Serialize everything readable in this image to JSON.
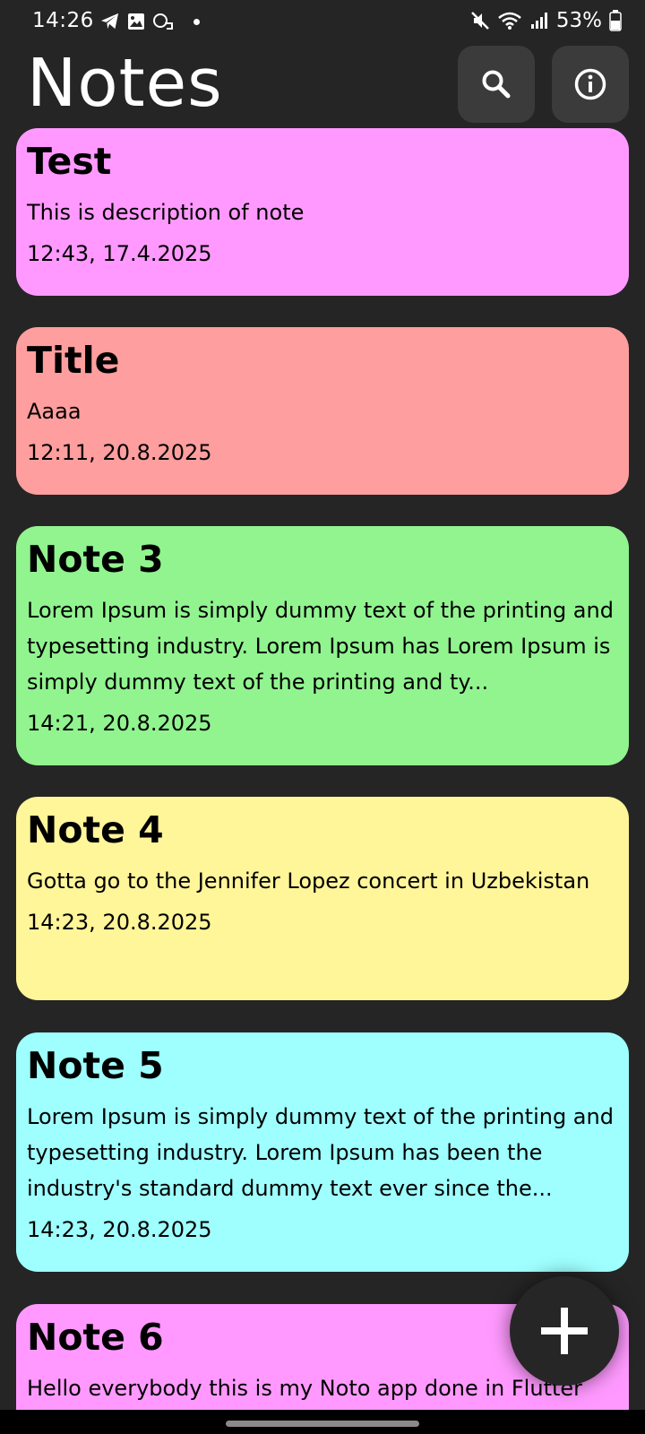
{
  "status_bar": {
    "time": "14:26",
    "battery_percent": "53%",
    "icons_left": [
      "telegram-icon",
      "gallery-icon",
      "link-icon",
      "notification-dot"
    ],
    "icons_right": [
      "mute-icon",
      "wifi-icon",
      "signal-icon",
      "battery-icon"
    ]
  },
  "header": {
    "title": "Notes",
    "search_icon": "search-icon",
    "info_icon": "info-icon"
  },
  "colors": {
    "background": "#252525",
    "header_button": "#3b3b3b",
    "pink": "#ff99ff",
    "salmon": "#ff9e9e",
    "green": "#91f48f",
    "yellow": "#fff599",
    "cyan": "#9efffe"
  },
  "notes": [
    {
      "title": "Test",
      "description": "This is description of note",
      "date": "12:43, 17.4.2025",
      "color": "#ff99ff"
    },
    {
      "title": "Title",
      "description": "Aaaa",
      "date": "12:11, 20.8.2025",
      "color": "#ff9e9e"
    },
    {
      "title": "Note 3",
      "description": "Lorem Ipsum is simply dummy text of the printing and typesetting industry. Lorem Ipsum has Lorem Ipsum is simply dummy text of the printing and ty...",
      "date": "14:21, 20.8.2025",
      "color": "#91f48f"
    },
    {
      "title": "Note 4",
      "description": "Gotta go to the Jennifer Lopez concert in Uzbekistan",
      "date": "14:23, 20.8.2025",
      "color": "#fff599"
    },
    {
      "title": "Note 5",
      "description": "Lorem Ipsum is simply dummy text of the printing and typesetting industry. Lorem Ipsum has been the industry's standard dummy text ever since the...",
      "date": "14:23, 20.8.2025",
      "color": "#9efffe"
    },
    {
      "title": "Note 6",
      "description": "Hello everybody this is my Noto app done in Flutter",
      "date": "",
      "color": "#ff99ff"
    }
  ],
  "fab": {
    "icon": "plus-icon"
  }
}
